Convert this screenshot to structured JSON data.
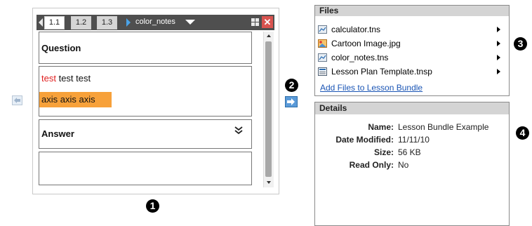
{
  "document": {
    "tabs": [
      "1.1",
      "1.2",
      "1.3"
    ],
    "name": "color_notes",
    "boxes": {
      "question_title": "Question",
      "text_red": "test",
      "text_black": " test test",
      "highlight_text": "axis axis axis",
      "answer_title": "Answer",
      "answer_icon": "double-chevron-down-icon"
    }
  },
  "files": {
    "header": "Files",
    "items": [
      {
        "name": "calculator.tns",
        "icon": "tns-file-icon"
      },
      {
        "name": "Cartoon Image.jpg",
        "icon": "image-file-icon"
      },
      {
        "name": "color_notes.tns",
        "icon": "tns-file-icon"
      },
      {
        "name": "Lesson Plan Template.tnsp",
        "icon": "template-file-icon"
      }
    ],
    "add_link": "Add Files to Lesson Bundle"
  },
  "details": {
    "header": "Details",
    "rows": [
      {
        "label": "Name:",
        "value": "Lesson Bundle Example"
      },
      {
        "label": "Date Modified:",
        "value": "11/11/10"
      },
      {
        "label": "Size:",
        "value": "56 KB"
      },
      {
        "label": "Read Only:",
        "value": "No"
      }
    ]
  },
  "callouts": [
    "1",
    "2",
    "3",
    "4"
  ],
  "colors": {
    "titlebar": "#4f4f4f",
    "highlight": "#f7a13a",
    "red_text": "#e02020",
    "link": "#1a55b5",
    "close": "#d9534f"
  }
}
